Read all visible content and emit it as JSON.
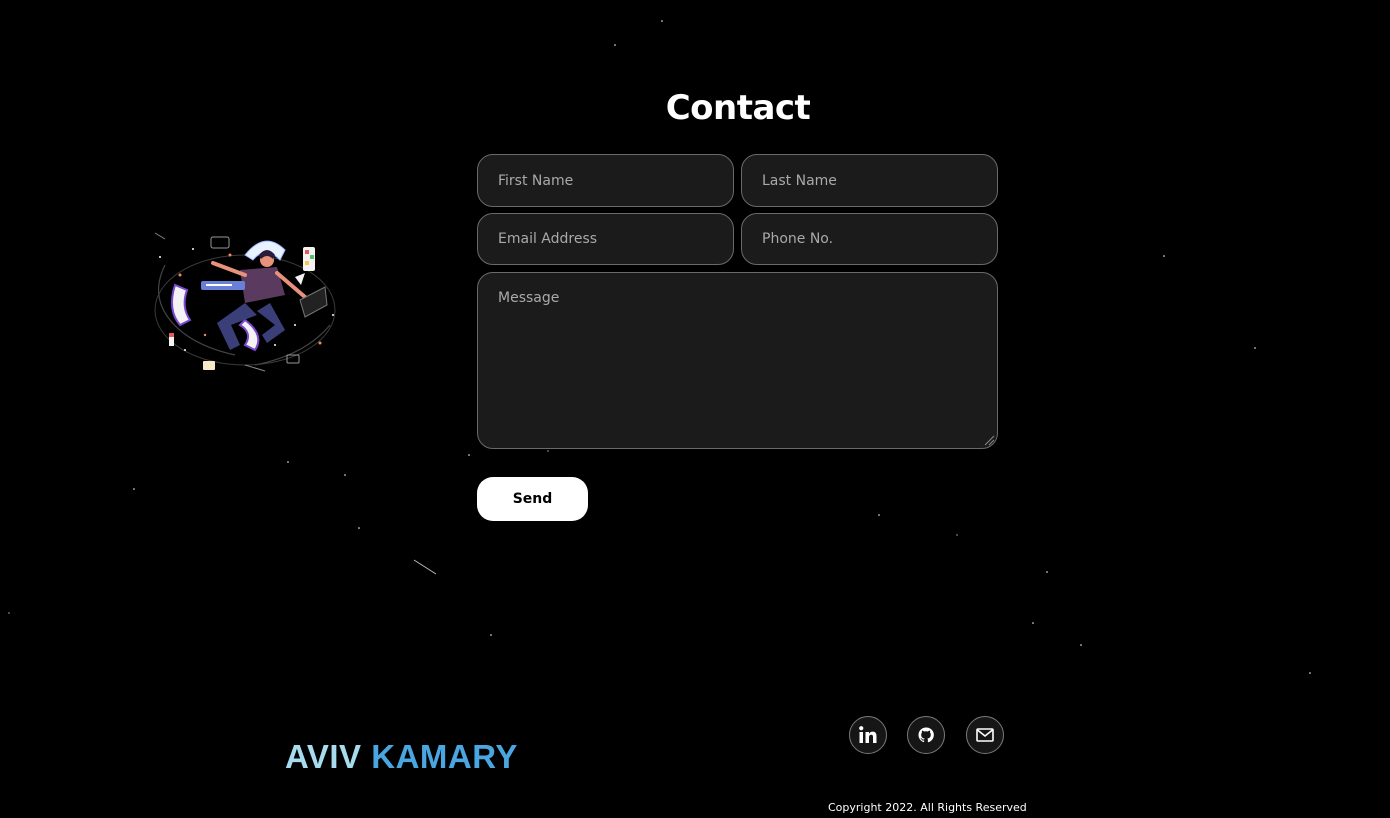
{
  "contact": {
    "title": "Contact",
    "form": {
      "first_name_placeholder": "First Name",
      "last_name_placeholder": "Last Name",
      "email_placeholder": "Email Address",
      "phone_placeholder": "Phone No.",
      "message_placeholder": "Message",
      "send_label": "Send"
    }
  },
  "footer": {
    "brand_first": "AVIV",
    "brand_last": "KAMARY",
    "social": [
      {
        "name": "linkedin",
        "icon": "linkedin-icon"
      },
      {
        "name": "github",
        "icon": "github-icon"
      },
      {
        "name": "email",
        "icon": "mail-icon"
      }
    ],
    "copyright": "Copyright 2022. All Rights Reserved"
  },
  "colors": {
    "background": "#000000",
    "field_background": "#1b1b1b",
    "field_border": "#6a6a6a",
    "brand_light": "#a7dcef",
    "brand_blue": "#4aa6e0",
    "send_background": "#ffffff"
  }
}
